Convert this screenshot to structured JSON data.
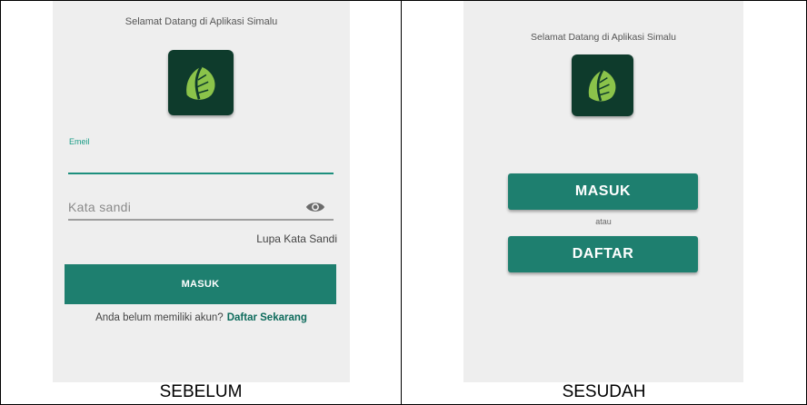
{
  "before": {
    "welcome_text": "Selamat Datang di Aplikasi Simalu",
    "email_label": "Emeil",
    "email_value": "",
    "password_placeholder": "Kata sandi",
    "forgot_password": "Lupa Kata Sandi",
    "login_button": "MASUK",
    "no_account_text": "Anda belum memiliki akun?",
    "register_link": "Daftar Sekarang",
    "caption": "SEBELUM"
  },
  "after": {
    "welcome_text": "Selamat Datang di Aplikasi Simalu",
    "login_button": "MASUK",
    "or_text": "atau",
    "register_button": "DAFTAR",
    "caption": "SESUDAH"
  },
  "colors": {
    "primary": "#1e7f6f",
    "logo_bg": "#0e3b2c",
    "leaf": "#8bc34a",
    "screen_bg": "#eeeeee"
  },
  "icons": {
    "logo": "leaf-icon",
    "password_toggle": "eye-icon"
  }
}
